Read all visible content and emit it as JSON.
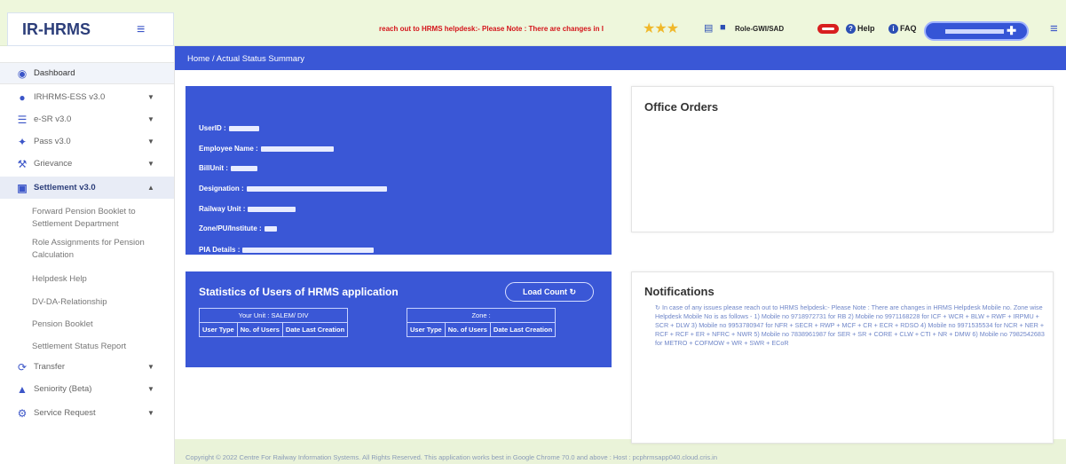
{
  "header": {
    "logo": "IR-HRMS",
    "marquee": "reach out to HRMS helpdesk:- Please Note : There are changes in",
    "marquee_suffix": "I",
    "role": "Role-GWI/SAD",
    "help": "Help",
    "faq": "FAQ"
  },
  "breadcrumb": {
    "home": "Home",
    "sep": "/",
    "current": "Actual Status Summary"
  },
  "sidebar": {
    "dashboard": "Dashboard",
    "items": [
      {
        "label": "IRHRMS-ESS v3.0"
      },
      {
        "label": "e-SR v3.0"
      },
      {
        "label": "Pass v3.0"
      },
      {
        "label": "Grievance"
      },
      {
        "label": "Settlement v3.0"
      },
      {
        "label": "Transfer"
      },
      {
        "label": "Seniority (Beta)"
      },
      {
        "label": "Service Request"
      }
    ],
    "sub_items": [
      {
        "label": "Forward Pension Booklet to Settlement Department"
      },
      {
        "label": "Role Assignments for Pension Calculation"
      },
      {
        "label": "Helpdesk Help"
      },
      {
        "label": "DV-DA-Relationship"
      },
      {
        "label": "Pension Booklet"
      },
      {
        "label": "Settlement Status Report"
      }
    ]
  },
  "user_info": {
    "userid_label": "UserID :",
    "name_label": "Employee Name :",
    "billunit_label": "BillUnit :",
    "designation_label": "Designation :",
    "railway_unit_label": "Railway Unit :",
    "zone_label": "Zone/PU/Institute :",
    "pia_label": "PIA Details :"
  },
  "office_orders": {
    "title": "Office Orders"
  },
  "stats": {
    "title": "Statistics of Users of HRMS application",
    "load_button": "Load Count",
    "unit_caption": "Your Unit : SALEM/ DIV",
    "zone_caption": "Zone :",
    "headers": [
      "User Type",
      "No. of Users",
      "Date Last Creation"
    ]
  },
  "notifications": {
    "title": "Notifications",
    "text": "In case of any issues please reach out to HRMS helpdesk:- Please Note : There are changes in HRMS Helpdesk Mobile no. Zone wise Helpdesk Mobile No is as follows - 1) Mobile no 9718972731 for RB 2) Mobile no 9971168228 for ICF + WCR + BLW + RWF + IRPMU + SCR + DLW 3) Mobile no 9953780947 for NFR + SECR + RWP + MCF + CR + ECR + RDSO 4) Mobile no 9971535534 for NCR + NER + RCF + RCF + ER + NFRC + NWR 5) Mobile no 7838961987 for SER + SR + CORE + CLW + CTI + NR + DMW 6) Mobile no 7982542683 for METRO + COFMOW + WR + SWR + ECoR"
  },
  "footer": {
    "text": "Copyright © 2022 Centre For Railway Information Systems. All Rights Reserved. This application works best in Google Chrome 70.0 and above : Host : pcphrmsapp040.cloud.cris.in"
  },
  "colors": {
    "primary": "#3a57d6",
    "alert": "#d4141a",
    "star": "#f0b82a"
  }
}
